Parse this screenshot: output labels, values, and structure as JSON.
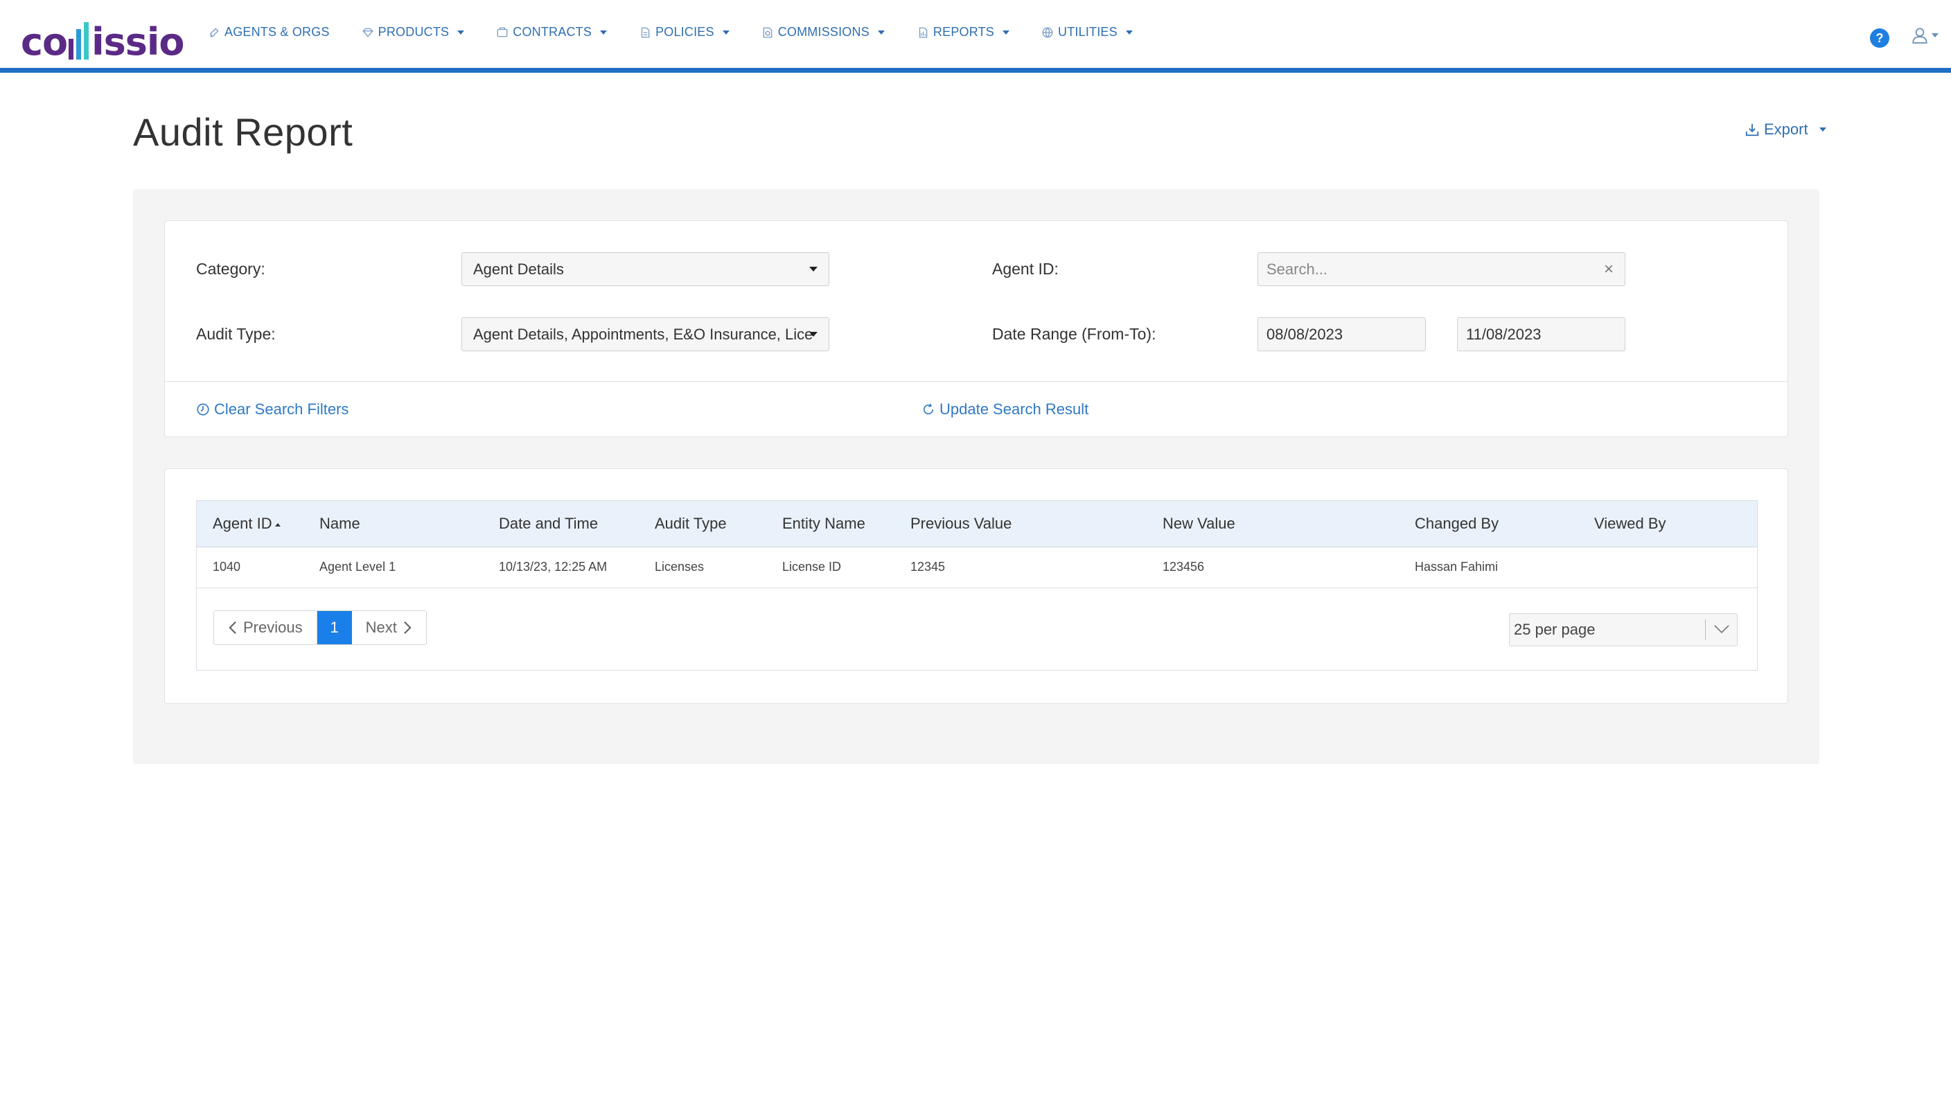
{
  "brand": {
    "logo_text_left": "co",
    "logo_text_right": "issio"
  },
  "nav": {
    "items": [
      {
        "label": "AGENTS & ORGS",
        "icon": "agents-icon",
        "dropdown": false
      },
      {
        "label": "PRODUCTS",
        "icon": "products-icon",
        "dropdown": true
      },
      {
        "label": "CONTRACTS",
        "icon": "contracts-icon",
        "dropdown": true
      },
      {
        "label": "POLICIES",
        "icon": "policies-icon",
        "dropdown": true
      },
      {
        "label": "COMMISSIONS",
        "icon": "commissions-icon",
        "dropdown": true
      },
      {
        "label": "REPORTS",
        "icon": "reports-icon",
        "dropdown": true
      },
      {
        "label": "UTILITIES",
        "icon": "utilities-icon",
        "dropdown": true
      }
    ],
    "help_label": "?"
  },
  "page": {
    "title": "Audit Report",
    "export_label": "Export"
  },
  "filters": {
    "category_label": "Category:",
    "category_value": "Agent Details",
    "audit_type_label": "Audit Type:",
    "audit_type_value": "Agent Details, Appointments, E&O Insurance, Lice",
    "agent_id_label": "Agent ID:",
    "agent_id_placeholder": "Search...",
    "date_range_label": "Date Range (From-To):",
    "date_from": "08/08/2023",
    "date_to": "11/08/2023",
    "clear_label": "Clear Search Filters",
    "update_label": "Update Search Result"
  },
  "table": {
    "columns": [
      "Agent ID",
      "Name",
      "Date and Time",
      "Audit Type",
      "Entity Name",
      "Previous Value",
      "New Value",
      "Changed By",
      "Viewed By"
    ],
    "rows": [
      [
        "1040",
        "Agent Level 1",
        "10/13/23, 12:25 AM",
        "Licenses",
        "License ID",
        "12345",
        "123456",
        "Hassan Fahimi",
        ""
      ]
    ]
  },
  "pagination": {
    "previous_label": "Previous",
    "current_page": "1",
    "next_label": "Next",
    "per_page": "25 per page"
  },
  "colors": {
    "accent": "#1e6fc4",
    "brand_purple": "#5b2a86",
    "link": "#2f79c4",
    "header_bg": "#e9f2fb"
  }
}
